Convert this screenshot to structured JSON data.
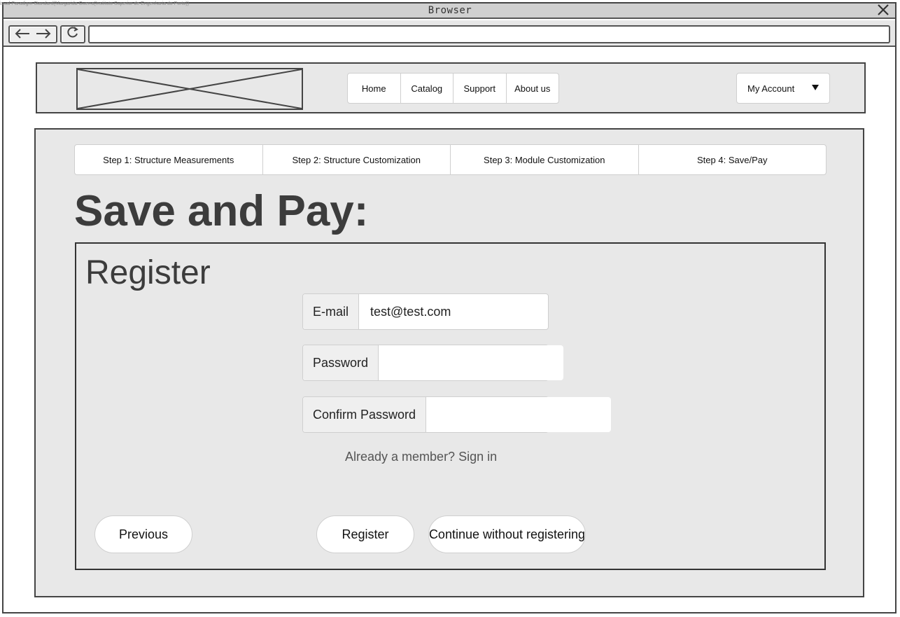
{
  "browser": {
    "watermark": "isual Paradigm Standard(Margarida Guerra(Instituto Superior de Engenharia do Porto))",
    "title": "Browser",
    "close_icon": "close-icon",
    "back_icon": "arrow-left-icon",
    "forward_icon": "arrow-right-icon",
    "reload_icon": "reload-icon",
    "address": ""
  },
  "header": {
    "logo": "image-placeholder",
    "menu": [
      {
        "label": "Home"
      },
      {
        "label": "Catalog"
      },
      {
        "label": "Support"
      },
      {
        "label": "About us"
      }
    ],
    "account": {
      "label": "My Account",
      "caret_icon": "caret-down-icon"
    }
  },
  "steps": [
    {
      "label": "Step 1: Structure Measurements"
    },
    {
      "label": "Step 2: Structure Customization"
    },
    {
      "label": "Step 3: Module Customization"
    },
    {
      "label": "Step 4: Save/Pay"
    }
  ],
  "page": {
    "heading": "Save and Pay:"
  },
  "register": {
    "title": "Register",
    "email": {
      "label": "E-mail",
      "value": "test@test.com"
    },
    "password": {
      "label": "Password",
      "value": ""
    },
    "confirm_password": {
      "label": "Confirm Password",
      "value": ""
    },
    "signin_link": "Already a member? Sign in"
  },
  "buttons": {
    "previous": "Previous",
    "register": "Register",
    "continue": "Continue without registering"
  }
}
